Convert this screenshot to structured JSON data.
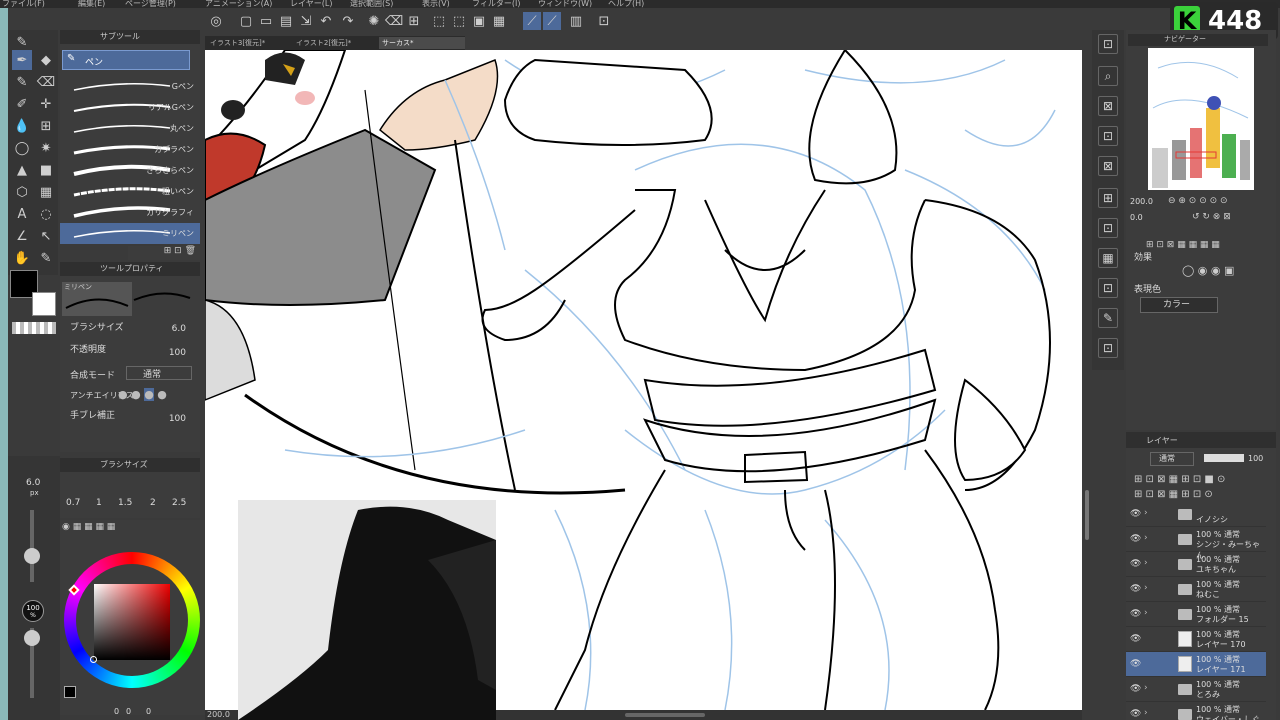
{
  "menu": {
    "items": [
      "ファイル(F)",
      "編集(E)",
      "ページ管理(P)",
      "アニメーション(A)",
      "レイヤー(L)",
      "選択範囲(S)",
      "表示(V)",
      "フィルター(I)",
      "ウィンドウ(W)",
      "ヘルプ(H)"
    ]
  },
  "tabs": [
    {
      "label": "イラスト3[復元]*"
    },
    {
      "label": "イラスト2[復元]*"
    },
    {
      "label": "サーカス*"
    }
  ],
  "subtool": {
    "header": "サブツール",
    "selected": "ペン",
    "brushes": [
      "Gペン",
      "リアルGペン",
      "丸ペン",
      "カブラペン",
      "さらさらペン",
      "粗いペン",
      "カリグラフィ",
      "ミリペン"
    ]
  },
  "toolprop": {
    "header": "ツールプロパティ",
    "preview_label": "ミリペン",
    "brush_size_label": "ブラシサイズ",
    "brush_size_value": "6.0",
    "opacity_label": "不透明度",
    "opacity_value": "100",
    "blend_label": "合成モード",
    "blend_value": "通常",
    "antialias_label": "アンチエイリアス",
    "stabilize_label": "手ブレ補正",
    "stabilize_value": "100"
  },
  "brushsize": {
    "header": "ブラシサイズ",
    "sizes": [
      "0.7",
      "1",
      "1.5",
      "2",
      "2.5"
    ]
  },
  "color": {
    "size_display": "6.0",
    "size_unit": "px",
    "opacity_display": "100",
    "opacity_unit": "%",
    "bottom_values": [
      "0",
      "0",
      "0"
    ],
    "main_color": "#000000",
    "sub_color": "#ffffff"
  },
  "canvas": {
    "zoom": "200.0"
  },
  "navigator": {
    "title": "ナビゲーター",
    "zoom": "200.0",
    "rotate": "0.0"
  },
  "effect": {
    "title": "効果",
    "expression_label": "表現色",
    "expression_value": "カラー"
  },
  "layers": {
    "title": "レイヤー",
    "blend": "通常",
    "opacity": "100",
    "rows": [
      {
        "line1": "",
        "line2": "イノシシ",
        "type": "folder",
        "selected": false
      },
      {
        "line1": "100 % 通常",
        "line2": "シンジ・みーちゃん",
        "type": "folder",
        "selected": false
      },
      {
        "line1": "100 % 通常",
        "line2": "ユキちゃん",
        "type": "folder",
        "selected": false
      },
      {
        "line1": "100 % 通常",
        "line2": "ねむこ",
        "type": "folder",
        "selected": false
      },
      {
        "line1": "100 % 通常",
        "line2": "フォルダー 15",
        "type": "folder",
        "selected": false
      },
      {
        "line1": "100 % 通常",
        "line2": "レイヤー 170",
        "type": "layer",
        "selected": false
      },
      {
        "line1": "100 % 通常",
        "line2": "レイヤー 171",
        "type": "layer",
        "selected": true
      },
      {
        "line1": "100 % 通常",
        "line2": "とろみ",
        "type": "folder",
        "selected": false
      },
      {
        "line1": "100 % 通常",
        "line2": "ウェイバー・しぐ",
        "type": "folder",
        "selected": false
      }
    ]
  },
  "badge": {
    "letter": "K",
    "count": "448",
    "color": "#3bd13b"
  }
}
